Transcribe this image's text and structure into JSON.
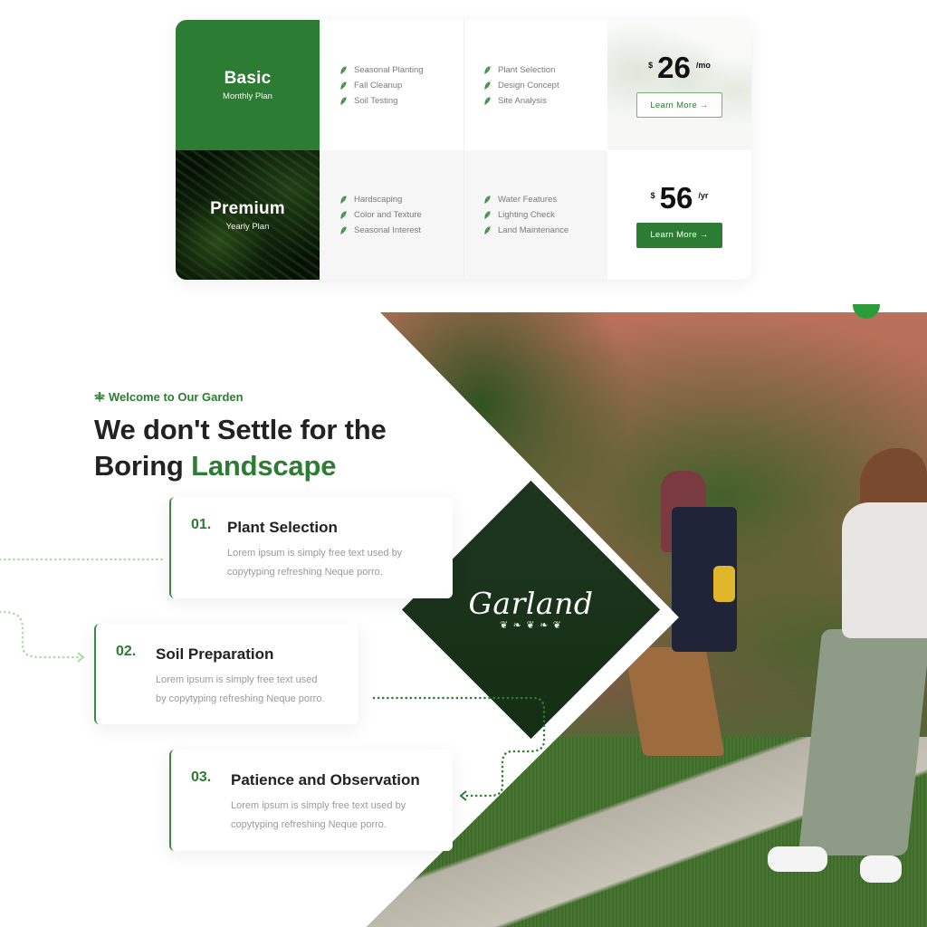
{
  "pricing": {
    "plans": [
      {
        "name": "Basic",
        "subtitle": "Monthly Plan",
        "features_col1": [
          "Seasonal Planting",
          "Fall Cleanup",
          "Soil Testing"
        ],
        "features_col2": [
          "Plant Selection",
          "Design Concept",
          "Site Analysis"
        ],
        "currency": "$",
        "amount": "26",
        "period": "/mo",
        "button_label": "Learn More →",
        "button_style": "outline"
      },
      {
        "name": "Premium",
        "subtitle": "Yearly Plan",
        "features_col1": [
          "Hardscaping",
          "Color and Texture",
          "Seasonal Interest"
        ],
        "features_col2": [
          "Water Features",
          "Lighting Check",
          "Land Maintenance"
        ],
        "currency": "$",
        "amount": "56",
        "period": "/yr",
        "button_label": "Learn More →",
        "button_style": "solid"
      }
    ],
    "feature_icon": "leaf-icon"
  },
  "hero": {
    "eyebrow": "Welcome to Our Garden",
    "eyebrow_icon": "sprout-icon",
    "headline_line1": "We don't Settle for the",
    "headline_line2_plain": "Boring ",
    "headline_line2_accent": "Landscape",
    "brand": "Garland",
    "brand_ornament": "❦ ❧ ❦ ❧ ❦",
    "steps": [
      {
        "number": "01.",
        "title": "Plant Selection",
        "description_line1": "Lorem ipsum is simply free text used by",
        "description_line2": "copytyping refreshing Neque porro."
      },
      {
        "number": "02.",
        "title": "Soil Preparation",
        "description_line1": "Lorem ipsum is simply free text used",
        "description_line2": "by copytyping refreshing Neque porro."
      },
      {
        "number": "03.",
        "title": "Patience and Observation",
        "description_line1": "Lorem ipsum is simply free text used by",
        "description_line2": "copytyping refreshing Neque porro."
      }
    ]
  },
  "colors": {
    "brand_green": "#2c7d33",
    "dark_green": "#102a12",
    "light_dots": "#a8dca0",
    "text_dark": "#222222",
    "text_muted": "#9a9a9a"
  }
}
